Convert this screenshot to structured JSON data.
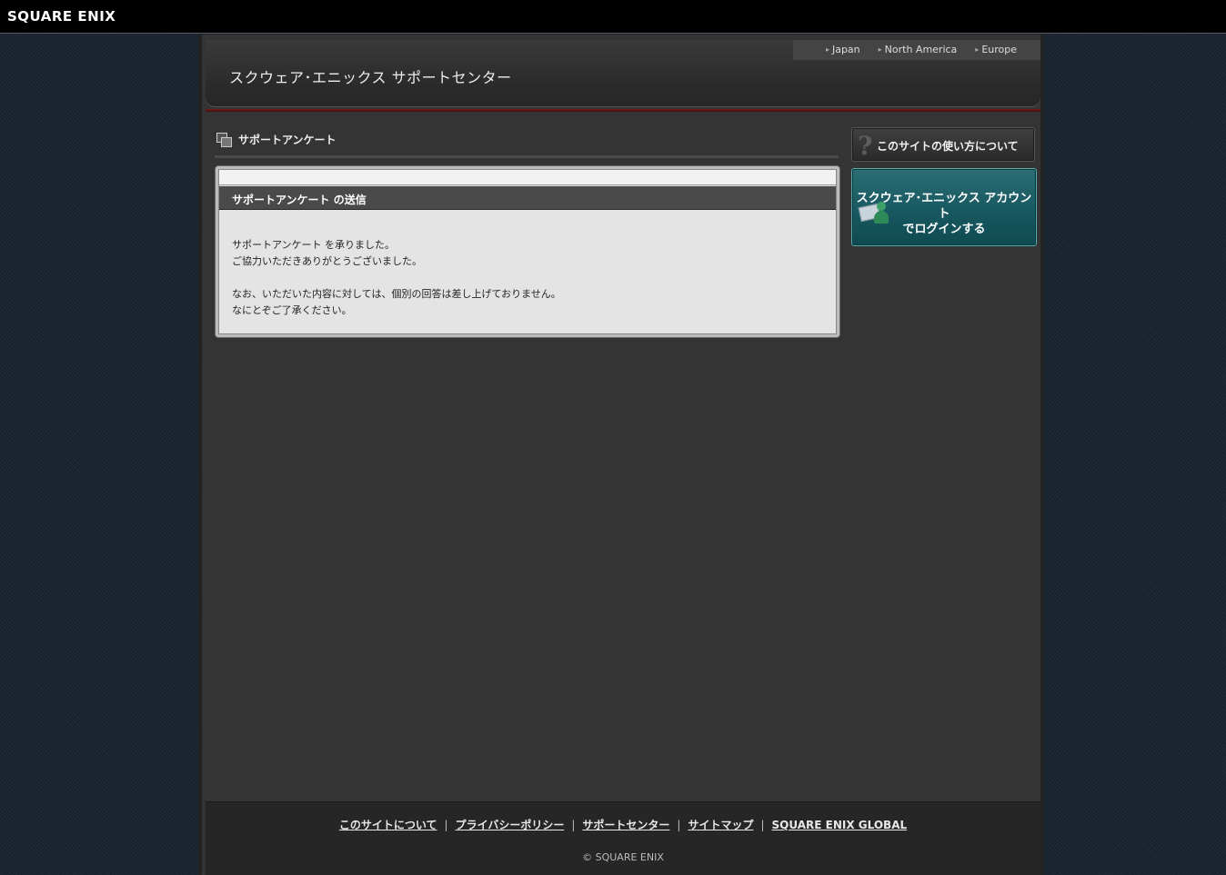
{
  "brand": {
    "logo_text": "SQUARE ENIX"
  },
  "header": {
    "site_title": "スクウェア･エニックス サポートセンター",
    "regions": [
      "Japan",
      "North America",
      "Europe"
    ]
  },
  "section": {
    "title": "サポートアンケート"
  },
  "panel": {
    "title": "サポートアンケート の送信",
    "body": [
      [
        "サポートアンケート を承りました。",
        "ご協力いただきありがとうございました。"
      ],
      [
        "なお、いただいた内容に対しては、個別の回答は差し上げておりません。",
        "なにとぞご了承ください。"
      ]
    ]
  },
  "sidebar": {
    "howto_icon": "question-mark-icon",
    "howto_label": "このサイトの使い方について",
    "login_line1": "スクウェア･エニックス アカウント",
    "login_line2": "でログインする",
    "login_icon": "account-card-person-icon"
  },
  "footer": {
    "links": [
      "このサイトについて",
      "プライバシーポリシー",
      "サポートセンター",
      "サイトマップ",
      "SQUARE ENIX GLOBAL"
    ],
    "copyright": "© SQUARE ENIX"
  },
  "colors": {
    "background": "#1b2633",
    "main": "#343434",
    "accent_red": "#7a1a1a",
    "login_teal": "#1a5a62"
  }
}
